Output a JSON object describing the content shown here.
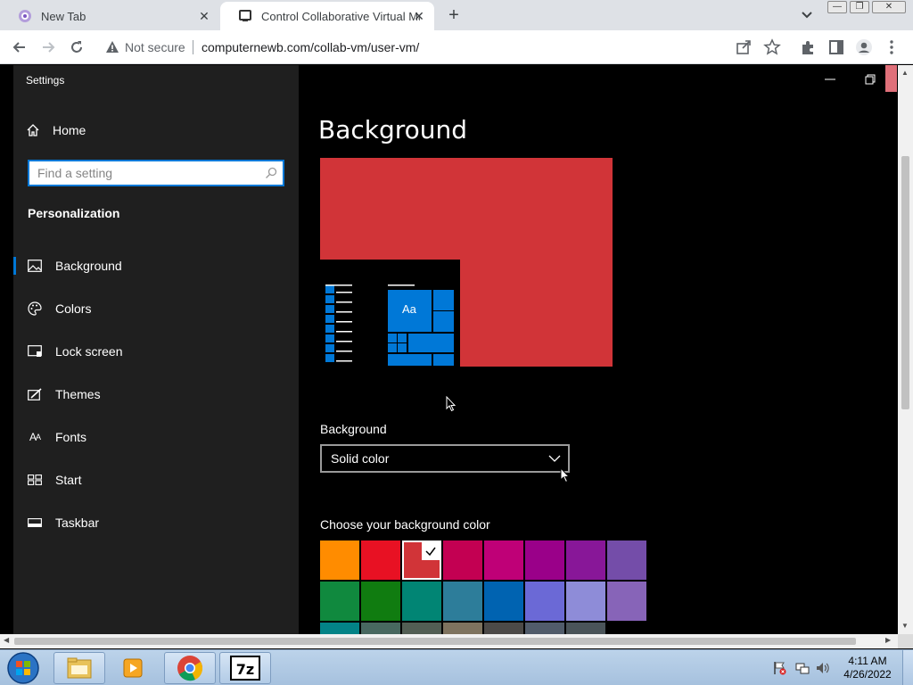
{
  "browser": {
    "tabs": [
      {
        "title": "New Tab",
        "active": false
      },
      {
        "title": "Control Collaborative Virtual Ma",
        "active": true
      }
    ],
    "security_label": "Not secure",
    "url": "computernewb.com/collab-vm/user-vm/"
  },
  "settings": {
    "window_title": "Settings",
    "home_label": "Home",
    "search_placeholder": "Find a setting",
    "section_title": "Personalization",
    "nav_items": [
      {
        "label": "Background",
        "icon": "picture-icon",
        "active": true
      },
      {
        "label": "Colors",
        "icon": "palette-icon",
        "active": false
      },
      {
        "label": "Lock screen",
        "icon": "lock-screen-icon",
        "active": false
      },
      {
        "label": "Themes",
        "icon": "themes-icon",
        "active": false
      },
      {
        "label": "Fonts",
        "icon": "fonts-icon",
        "active": false
      },
      {
        "label": "Start",
        "icon": "start-icon",
        "active": false
      },
      {
        "label": "Taskbar",
        "icon": "taskbar-icon",
        "active": false
      }
    ],
    "page_title": "Background",
    "preview": {
      "tile_text": "Aa",
      "background_color": "#d13438",
      "accent_color": "#0078d7"
    },
    "background_label": "Background",
    "background_value": "Solid color",
    "color_label": "Choose your background color",
    "swatch_rows": [
      [
        "#ff8c00",
        "#e81123",
        "#d13438",
        "#c30052",
        "#bf0077",
        "#9a0089",
        "#881798",
        "#744da9"
      ],
      [
        "#10893e",
        "#107c10",
        "#018574",
        "#2d7d9a",
        "#0063b1",
        "#6b69d6",
        "#8e8cd8",
        "#8764b8"
      ],
      [
        "#038387",
        "#486860",
        "#525e54",
        "#7e735f",
        "#4c4a48",
        "#515c6b",
        "#4a5459",
        "#000000"
      ]
    ],
    "selected_swatch": "#d13438"
  },
  "taskbar": {
    "time": "4:11 AM",
    "date": "4/26/2022"
  }
}
